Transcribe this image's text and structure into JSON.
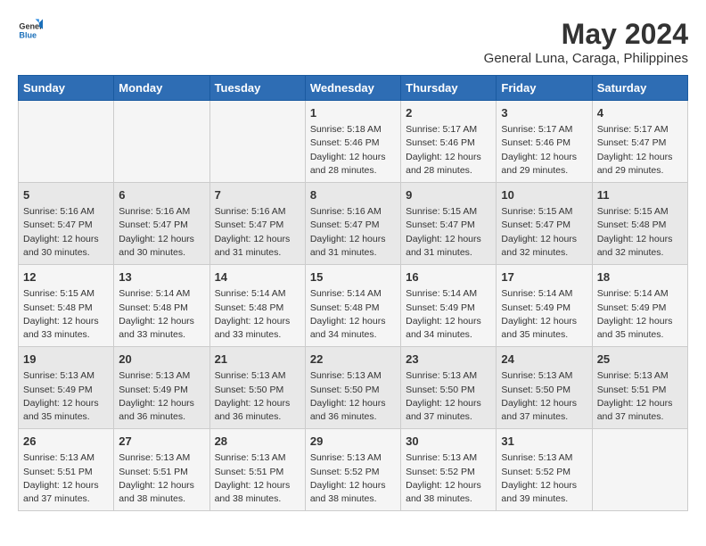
{
  "header": {
    "logo_general": "General",
    "logo_blue": "Blue",
    "title": "May 2024",
    "subtitle": "General Luna, Caraga, Philippines"
  },
  "days_of_week": [
    "Sunday",
    "Monday",
    "Tuesday",
    "Wednesday",
    "Thursday",
    "Friday",
    "Saturday"
  ],
  "weeks": [
    [
      {
        "day": "",
        "info": ""
      },
      {
        "day": "",
        "info": ""
      },
      {
        "day": "",
        "info": ""
      },
      {
        "day": "1",
        "info": "Sunrise: 5:18 AM\nSunset: 5:46 PM\nDaylight: 12 hours\nand 28 minutes."
      },
      {
        "day": "2",
        "info": "Sunrise: 5:17 AM\nSunset: 5:46 PM\nDaylight: 12 hours\nand 28 minutes."
      },
      {
        "day": "3",
        "info": "Sunrise: 5:17 AM\nSunset: 5:46 PM\nDaylight: 12 hours\nand 29 minutes."
      },
      {
        "day": "4",
        "info": "Sunrise: 5:17 AM\nSunset: 5:47 PM\nDaylight: 12 hours\nand 29 minutes."
      }
    ],
    [
      {
        "day": "5",
        "info": "Sunrise: 5:16 AM\nSunset: 5:47 PM\nDaylight: 12 hours\nand 30 minutes."
      },
      {
        "day": "6",
        "info": "Sunrise: 5:16 AM\nSunset: 5:47 PM\nDaylight: 12 hours\nand 30 minutes."
      },
      {
        "day": "7",
        "info": "Sunrise: 5:16 AM\nSunset: 5:47 PM\nDaylight: 12 hours\nand 31 minutes."
      },
      {
        "day": "8",
        "info": "Sunrise: 5:16 AM\nSunset: 5:47 PM\nDaylight: 12 hours\nand 31 minutes."
      },
      {
        "day": "9",
        "info": "Sunrise: 5:15 AM\nSunset: 5:47 PM\nDaylight: 12 hours\nand 31 minutes."
      },
      {
        "day": "10",
        "info": "Sunrise: 5:15 AM\nSunset: 5:47 PM\nDaylight: 12 hours\nand 32 minutes."
      },
      {
        "day": "11",
        "info": "Sunrise: 5:15 AM\nSunset: 5:48 PM\nDaylight: 12 hours\nand 32 minutes."
      }
    ],
    [
      {
        "day": "12",
        "info": "Sunrise: 5:15 AM\nSunset: 5:48 PM\nDaylight: 12 hours\nand 33 minutes."
      },
      {
        "day": "13",
        "info": "Sunrise: 5:14 AM\nSunset: 5:48 PM\nDaylight: 12 hours\nand 33 minutes."
      },
      {
        "day": "14",
        "info": "Sunrise: 5:14 AM\nSunset: 5:48 PM\nDaylight: 12 hours\nand 33 minutes."
      },
      {
        "day": "15",
        "info": "Sunrise: 5:14 AM\nSunset: 5:48 PM\nDaylight: 12 hours\nand 34 minutes."
      },
      {
        "day": "16",
        "info": "Sunrise: 5:14 AM\nSunset: 5:49 PM\nDaylight: 12 hours\nand 34 minutes."
      },
      {
        "day": "17",
        "info": "Sunrise: 5:14 AM\nSunset: 5:49 PM\nDaylight: 12 hours\nand 35 minutes."
      },
      {
        "day": "18",
        "info": "Sunrise: 5:14 AM\nSunset: 5:49 PM\nDaylight: 12 hours\nand 35 minutes."
      }
    ],
    [
      {
        "day": "19",
        "info": "Sunrise: 5:13 AM\nSunset: 5:49 PM\nDaylight: 12 hours\nand 35 minutes."
      },
      {
        "day": "20",
        "info": "Sunrise: 5:13 AM\nSunset: 5:49 PM\nDaylight: 12 hours\nand 36 minutes."
      },
      {
        "day": "21",
        "info": "Sunrise: 5:13 AM\nSunset: 5:50 PM\nDaylight: 12 hours\nand 36 minutes."
      },
      {
        "day": "22",
        "info": "Sunrise: 5:13 AM\nSunset: 5:50 PM\nDaylight: 12 hours\nand 36 minutes."
      },
      {
        "day": "23",
        "info": "Sunrise: 5:13 AM\nSunset: 5:50 PM\nDaylight: 12 hours\nand 37 minutes."
      },
      {
        "day": "24",
        "info": "Sunrise: 5:13 AM\nSunset: 5:50 PM\nDaylight: 12 hours\nand 37 minutes."
      },
      {
        "day": "25",
        "info": "Sunrise: 5:13 AM\nSunset: 5:51 PM\nDaylight: 12 hours\nand 37 minutes."
      }
    ],
    [
      {
        "day": "26",
        "info": "Sunrise: 5:13 AM\nSunset: 5:51 PM\nDaylight: 12 hours\nand 37 minutes."
      },
      {
        "day": "27",
        "info": "Sunrise: 5:13 AM\nSunset: 5:51 PM\nDaylight: 12 hours\nand 38 minutes."
      },
      {
        "day": "28",
        "info": "Sunrise: 5:13 AM\nSunset: 5:51 PM\nDaylight: 12 hours\nand 38 minutes."
      },
      {
        "day": "29",
        "info": "Sunrise: 5:13 AM\nSunset: 5:52 PM\nDaylight: 12 hours\nand 38 minutes."
      },
      {
        "day": "30",
        "info": "Sunrise: 5:13 AM\nSunset: 5:52 PM\nDaylight: 12 hours\nand 38 minutes."
      },
      {
        "day": "31",
        "info": "Sunrise: 5:13 AM\nSunset: 5:52 PM\nDaylight: 12 hours\nand 39 minutes."
      },
      {
        "day": "",
        "info": ""
      }
    ]
  ]
}
